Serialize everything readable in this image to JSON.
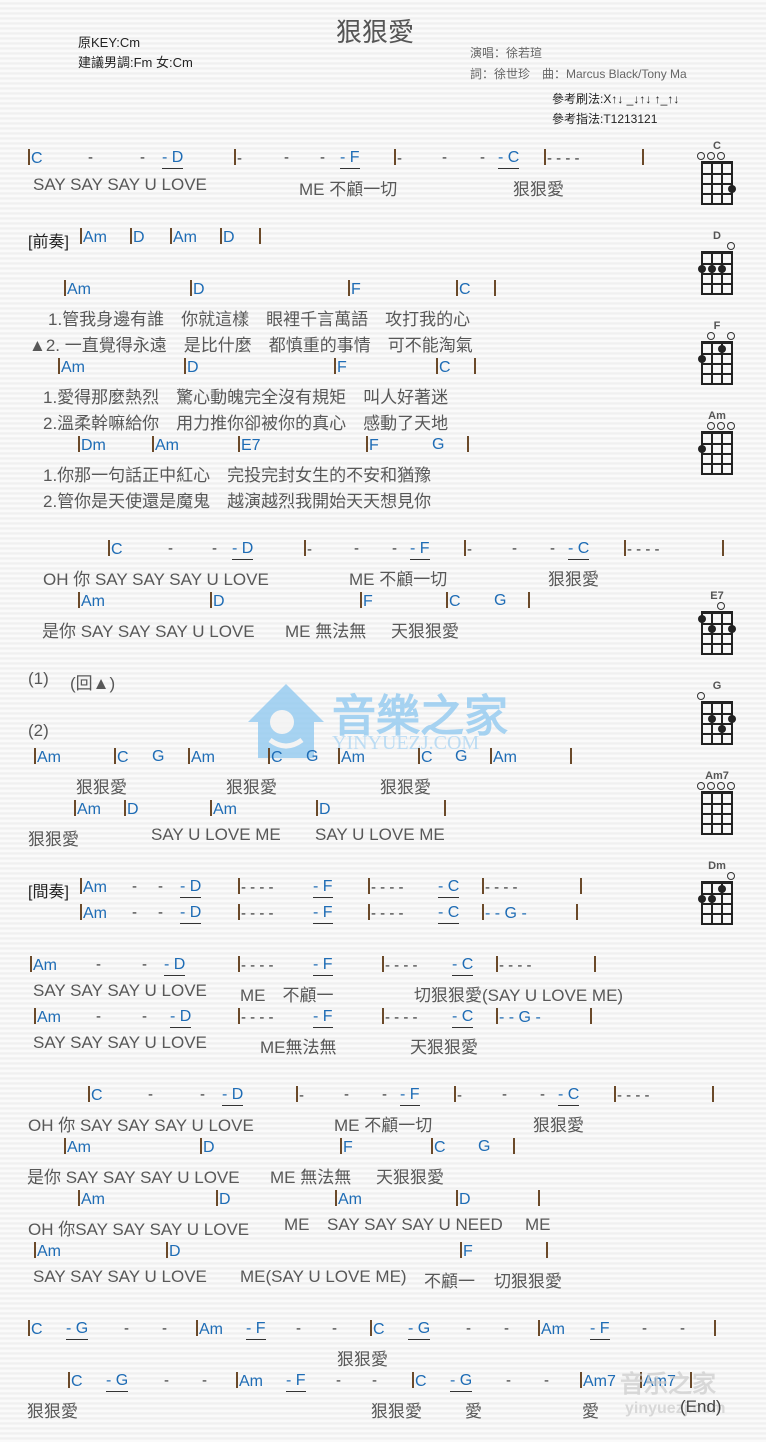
{
  "header": {
    "title": "狠狠愛",
    "original_key": "原KEY:Cm",
    "suggested_key": "建議男調:Fm 女:Cm",
    "singer": "演唱：徐若瑄",
    "credits": "詞：徐世珍　曲：Marcus Black/Tony Ma",
    "strum": "參考刷法:X↑↓ _↓↑↓ ↑_↑↓",
    "pick": "參考指法:T1213121"
  },
  "colors": {
    "chord": "#1e6cb5",
    "lyric": "#585858",
    "bar": "#6b4a2a"
  },
  "labels": {
    "intro": "[前奏]",
    "interlude": "[間奏]",
    "part1": "(1)",
    "back": "(回▲)",
    "part2": "(2)",
    "end": "(End)"
  },
  "lines": {
    "l1_chords": [
      "C",
      "-",
      "-",
      "- D",
      "-",
      "-",
      "-",
      "- F",
      "-",
      "-",
      "-",
      "- C",
      "- - - -"
    ],
    "l1_lyric": [
      "SAY SAY SAY U LOVE",
      "ME 不顧一切",
      "狠狠愛"
    ],
    "intro_chords": [
      "Am",
      "D",
      "Am",
      "D"
    ],
    "v1_chords": [
      "Am",
      "D",
      "F",
      "C"
    ],
    "v1_lyric1": "1.管我身邊有誰　你就這樣　眼裡千言萬語　攻打我的心",
    "v1_lyric2": "▲2. 一直覺得永遠　是比什麼　都慎重的事情　可不能淘氣",
    "v2_chords": [
      "Am",
      "D",
      "F",
      "C"
    ],
    "v2_lyric1": "1.愛得那麼熱烈　驚心動魄完全沒有規矩　叫人好著迷",
    "v2_lyric2": "2.溫柔幹嘛給你　用力推你卻被你的真心　感動了天地",
    "v3_chords": [
      "Dm",
      "Am",
      "E7",
      "F",
      "G"
    ],
    "v3_lyric1": "1.你那一句話正中紅心　完投完封女生的不安和猶豫",
    "v3_lyric2": "2.管你是天使還是魔鬼　越演越烈我開始天天想見你",
    "c1_chords": [
      "C",
      "-",
      "-",
      "- D",
      "-",
      "-",
      "-",
      "- F",
      "-",
      "-",
      "-",
      "- C",
      "- - - -"
    ],
    "c1_lyric": [
      "OH 你 SAY SAY SAY U LOVE",
      "ME 不顧一切",
      "狠狠愛"
    ],
    "c2_chords": [
      "Am",
      "D",
      "F",
      "C",
      "G"
    ],
    "c2_lyric": [
      "是你 SAY SAY SAY U LOVE",
      "ME 無法無",
      "天狠狠愛"
    ],
    "p2_chords": [
      "Am",
      "C",
      "G",
      "Am",
      "C",
      "G",
      "Am",
      "C",
      "G",
      "Am"
    ],
    "p2_lyric": [
      "狠狠愛",
      "狠狠愛",
      "狠狠愛"
    ],
    "p2b_chords": [
      "Am",
      "D",
      "Am",
      "D"
    ],
    "p2b_lyric": [
      "狠狠愛",
      "SAY U LOVE ME",
      "SAY U LOVE ME"
    ],
    "int1_chords": [
      "Am",
      "-",
      "-",
      "- D",
      "- - - -",
      "- F",
      "- - - -",
      "- C",
      "- - - -"
    ],
    "int2_chords": [
      "Am",
      "-",
      "-",
      "- D",
      "- - - -",
      "- F",
      "- - - -",
      "- C",
      "- - G -"
    ],
    "b1_chords": [
      "Am",
      "-",
      "-",
      "- D",
      "- - - -",
      "- F",
      "- - - -",
      "- C",
      "- - - -"
    ],
    "b1_lyric": [
      "SAY SAY SAY U LOVE",
      "ME　不顧一",
      "切狠狠愛(SAY U LOVE ME)"
    ],
    "b2_chords": [
      "Am",
      "-",
      "-",
      "- D",
      "- - - -",
      "- F",
      "- - - -",
      "- C",
      "- - G -"
    ],
    "b2_lyric": [
      "SAY SAY SAY U LOVE",
      "ME無法無",
      "天狠狠愛"
    ],
    "d1_chords": [
      "C",
      "-",
      "-",
      "- D",
      "-",
      "-",
      "-",
      "- F",
      "-",
      "-",
      "-",
      "- C",
      "- - - -"
    ],
    "d1_lyric": [
      "OH 你 SAY SAY SAY U LOVE",
      "ME 不顧一切",
      "狠狠愛"
    ],
    "d2_chords": [
      "Am",
      "D",
      "F",
      "C",
      "G"
    ],
    "d2_lyric": [
      "是你 SAY SAY SAY U LOVE",
      "ME 無法無",
      "天狠狠愛"
    ],
    "d3_chords": [
      "Am",
      "D",
      "Am",
      "D"
    ],
    "d3_lyric": [
      "OH 你SAY SAY SAY U LOVE",
      "ME",
      "SAY SAY SAY U NEED",
      "ME"
    ],
    "d4_chords": [
      "Am",
      "D",
      "F"
    ],
    "d4_lyric": [
      "SAY SAY SAY U LOVE",
      "ME(SAY U LOVE ME)",
      "不顧一",
      "切狠狠愛"
    ],
    "o1_chords": [
      "C",
      "- G",
      "-",
      "-",
      "Am",
      "- F",
      "-",
      "-",
      "C",
      "- G",
      "-",
      "-",
      "Am",
      "- F",
      "-",
      "-"
    ],
    "o1_lyric": "狠狠愛",
    "o2_chords": [
      "C",
      "- G",
      "-",
      "-",
      "Am",
      "- F",
      "-",
      "-",
      "C",
      "- G",
      "-",
      "-",
      "Am7",
      "Am7"
    ],
    "o2_lyric": [
      "狠狠愛",
      "狠狠愛",
      "愛",
      "愛"
    ]
  },
  "diagrams": [
    {
      "name": "C",
      "opens": [
        0,
        1,
        2
      ]
    },
    {
      "name": "D",
      "opens": [
        3
      ]
    },
    {
      "name": "F",
      "opens": [
        1,
        3
      ]
    },
    {
      "name": "Am",
      "opens": [
        1,
        2,
        3
      ]
    },
    {
      "name": "E7",
      "opens": [
        2
      ]
    },
    {
      "name": "G",
      "opens": [
        0
      ]
    },
    {
      "name": "Am7",
      "opens": [
        0,
        1,
        2,
        3
      ]
    },
    {
      "name": "Dm",
      "opens": [
        3
      ]
    }
  ],
  "watermark": {
    "text": "音樂之家",
    "url_text": "YINYUEZJ.COM",
    "footer_text": "音乐之家",
    "footer_url": "yinyuezj.com"
  }
}
